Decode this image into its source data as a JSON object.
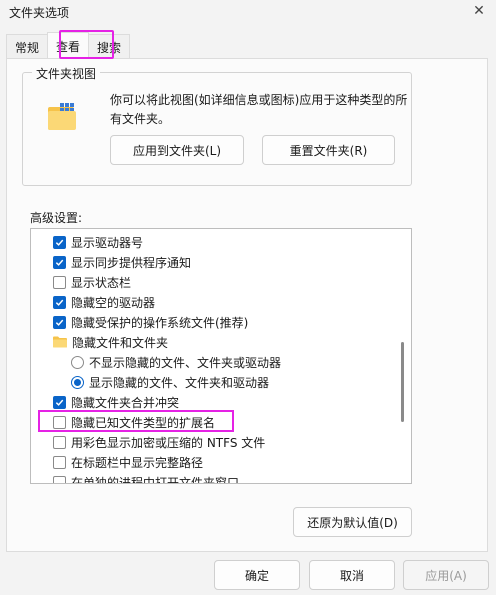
{
  "window": {
    "title": "文件夹选项"
  },
  "tabs": [
    {
      "label": "常规",
      "active": false
    },
    {
      "label": "查看",
      "active": true
    },
    {
      "label": "搜索",
      "active": false
    }
  ],
  "folder_views": {
    "legend": "文件夹视图",
    "description": "你可以将此视图(如详细信息或图标)应用于这种类型的所有文件夹。",
    "apply_button": "应用到文件夹(L)",
    "reset_button": "重置文件夹(R)"
  },
  "advanced": {
    "label": "高级设置:",
    "items": [
      {
        "type": "checkbox",
        "checked": true,
        "label": "显示驱动器号"
      },
      {
        "type": "checkbox",
        "checked": true,
        "label": "显示同步提供程序通知"
      },
      {
        "type": "checkbox",
        "checked": false,
        "label": "显示状态栏"
      },
      {
        "type": "checkbox",
        "checked": true,
        "label": "隐藏空的驱动器"
      },
      {
        "type": "checkbox",
        "checked": true,
        "label": "隐藏受保护的操作系统文件(推荐)"
      },
      {
        "type": "folder",
        "label": "隐藏文件和文件夹"
      },
      {
        "type": "radio",
        "checked": false,
        "label": "不显示隐藏的文件、文件夹或驱动器"
      },
      {
        "type": "radio",
        "checked": true,
        "label": "显示隐藏的文件、文件夹和驱动器"
      },
      {
        "type": "checkbox",
        "checked": true,
        "label": "隐藏文件夹合并冲突"
      },
      {
        "type": "checkbox",
        "checked": false,
        "label": "隐藏已知文件类型的扩展名"
      },
      {
        "type": "checkbox",
        "checked": false,
        "label": "用彩色显示加密或压缩的 NTFS 文件"
      },
      {
        "type": "checkbox",
        "checked": false,
        "label": "在标题栏中显示完整路径"
      },
      {
        "type": "checkbox",
        "checked": false,
        "label": "在单独的进程中打开文件夹窗口"
      }
    ],
    "restore_button": "还原为默认值(D)"
  },
  "footer": {
    "ok_button": "确定",
    "cancel_button": "取消",
    "apply_button": "应用(A)"
  },
  "colors": {
    "accent": "#0a64c8",
    "highlight": "#e522e5"
  }
}
